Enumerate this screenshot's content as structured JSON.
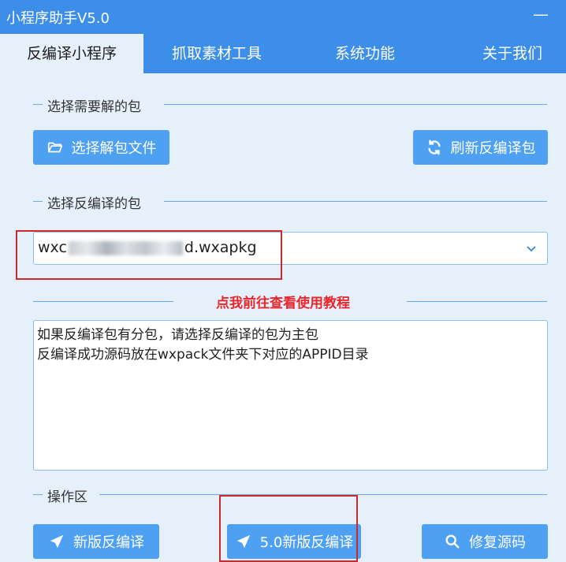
{
  "window": {
    "title": "小程序助手V5.0",
    "minimize_glyph": "—",
    "accent_color": "#3d8ee8"
  },
  "tabs": [
    {
      "label": "反编译小程序",
      "active": true
    },
    {
      "label": "抓取素材工具",
      "active": false
    },
    {
      "label": "系统功能",
      "active": false
    },
    {
      "label": "关于我们",
      "active": false
    }
  ],
  "section_select_unpack": {
    "label": "选择需要解的包",
    "choose_button": {
      "label": "选择解包文件",
      "icon": "folder-open-icon"
    },
    "refresh_button": {
      "label": "刷新反编译包",
      "icon": "refresh-icon"
    }
  },
  "section_select_decompile": {
    "label": "选择反编译的包",
    "dropdown": {
      "prefix": "wxc",
      "suffix": "d.wxapkg",
      "icon": "chevron-down-icon"
    }
  },
  "tutorial_link": "点我前往查看使用教程",
  "info_text": {
    "line1": "如果反编译包有分包，请选择反编译的包为主包",
    "line2": "反编译成功源码放在wxpack文件夹下对应的APPID目录"
  },
  "section_operations": {
    "label": "操作区",
    "buttons": [
      {
        "label": "新版反编译",
        "icon": "send-arrow-icon"
      },
      {
        "label": "5.0新版反编译",
        "icon": "send-arrow-icon"
      },
      {
        "label": "修复源码",
        "icon": "search-icon"
      }
    ]
  },
  "colors": {
    "button_blue": "#4da0f2",
    "link_red": "#e8262b",
    "highlight_red": "#cc2a2a"
  }
}
